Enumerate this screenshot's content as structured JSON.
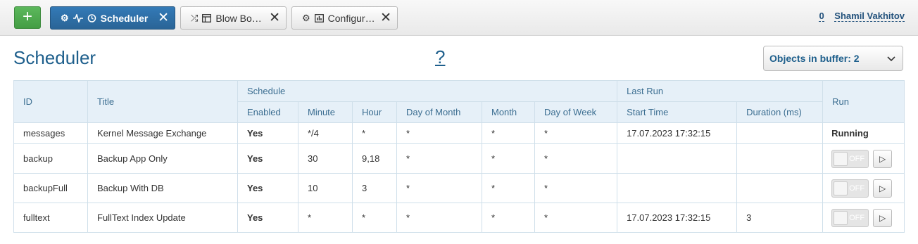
{
  "colors": {
    "accent": "#337ab7",
    "add": "#5cb85c",
    "header_bg": "#e6f0f8",
    "link": "#1e5f8c"
  },
  "topbar": {
    "add_label": "+",
    "tabs": [
      {
        "label": "Scheduler",
        "icons": [
          "gear-icon",
          "pulse-icon",
          "alarm-icon"
        ],
        "close": "✕",
        "active": true
      },
      {
        "label": "Blow Bo…",
        "icons": [
          "shuffle-icon",
          "table-icon"
        ],
        "close": "✕",
        "active": false
      },
      {
        "label": "Configur…",
        "icons": [
          "gear-icon",
          "chart-icon"
        ],
        "close": "✕",
        "active": false
      }
    ],
    "user": {
      "count": "0",
      "name": "Shamil Vakhitov"
    }
  },
  "page": {
    "title": "Scheduler",
    "help": "?",
    "buffer_label": "Objects in buffer: 2",
    "buffer_chevron": "chevron-down-icon"
  },
  "table": {
    "headers": {
      "id": "ID",
      "title": "Title",
      "schedule": "Schedule",
      "last_run": "Last Run",
      "run": "Run",
      "enabled": "Enabled",
      "minute": "Minute",
      "hour": "Hour",
      "day_of_month": "Day of Month",
      "month": "Month",
      "day_of_week": "Day of Week",
      "start_time": "Start Time",
      "duration": "Duration (ms)"
    },
    "rows": [
      {
        "id": "messages",
        "title": "Kernel Message Exchange",
        "enabled": "Yes",
        "minute": "*/4",
        "hour": "*",
        "dom": "*",
        "month": "*",
        "dow": "*",
        "start": "17.07.2023 17:32:15",
        "duration": "",
        "run_status": "Running"
      },
      {
        "id": "backup",
        "title": "Backup App Only",
        "enabled": "Yes",
        "minute": "30",
        "hour": "9,18",
        "dom": "*",
        "month": "*",
        "dow": "*",
        "start": "",
        "duration": "",
        "toggle": "OFF",
        "play": "▷"
      },
      {
        "id": "backupFull",
        "title": "Backup With DB",
        "enabled": "Yes",
        "minute": "10",
        "hour": "3",
        "dom": "*",
        "month": "*",
        "dow": "*",
        "start": "",
        "duration": "",
        "toggle": "OFF",
        "play": "▷"
      },
      {
        "id": "fulltext",
        "title": "FullText Index Update",
        "enabled": "Yes",
        "minute": "*",
        "hour": "*",
        "dom": "*",
        "month": "*",
        "dow": "*",
        "start": "17.07.2023 17:32:15",
        "duration": "3",
        "toggle": "OFF",
        "play": "▷"
      }
    ]
  }
}
